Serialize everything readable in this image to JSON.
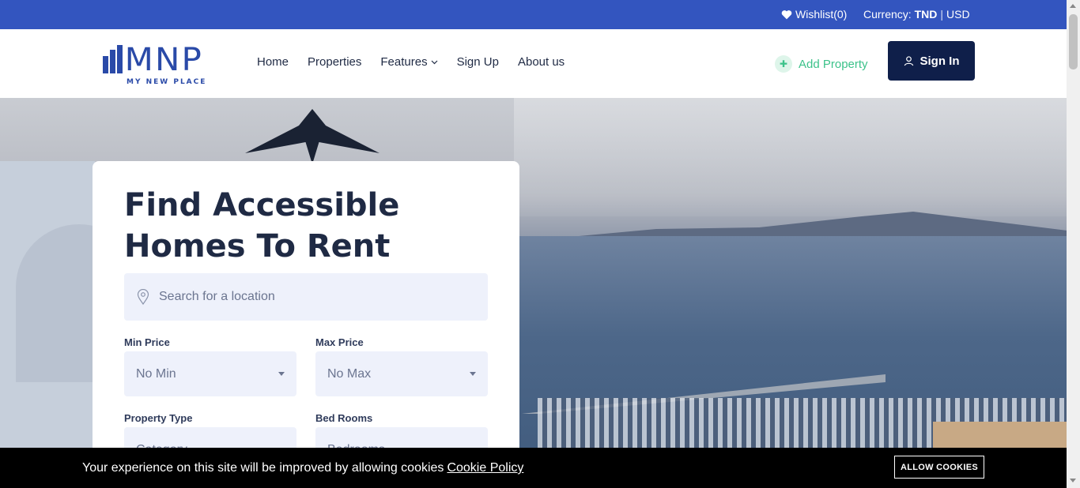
{
  "topbar": {
    "wishlist": "Wishlist(0)",
    "currency_label": "Currency:",
    "currency_tnd": "TND",
    "currency_sep": "|",
    "currency_usd": "USD"
  },
  "logo": {
    "name": "MNP",
    "tagline": "MY NEW PLACE"
  },
  "nav": {
    "home": "Home",
    "properties": "Properties",
    "features": "Features",
    "signup": "Sign Up",
    "about": "About us"
  },
  "add_property": "Add Property",
  "signin": "Sign In",
  "hero": {
    "title": "Find Accessible Homes To Rent",
    "location_placeholder": "Search for a location",
    "min_price_label": "Min Price",
    "min_price_value": "No Min",
    "max_price_label": "Max Price",
    "max_price_value": "No Max",
    "property_type_label": "Property Type",
    "property_type_value": "Category",
    "bedrooms_label": "Bed Rooms",
    "bedrooms_value": "Bedrooms"
  },
  "cookie": {
    "message": "Your experience on this site will be improved by allowing cookies",
    "policy_link": "Cookie Policy",
    "allow_button": "ALLOW COOKIES"
  },
  "colors": {
    "topbar": "#3355bf",
    "signin_bg": "#0f1f4a",
    "accent_green": "#3cc28a",
    "field_bg": "#eef1fb"
  }
}
